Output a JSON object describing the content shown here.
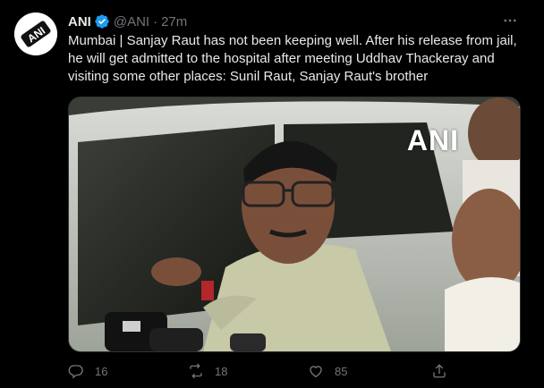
{
  "tweet": {
    "author_name": "ANI",
    "handle": "@ANI",
    "separator": "·",
    "time": "27m",
    "text": "Mumbai | Sanjay Raut has not been keeping well. After his release from jail,\nhe will get admitted to the hospital after meeting Uddhav Thackeray and\nvisiting some other places: Sunil Raut, Sanjay Raut's brother",
    "media_watermark": "ANI",
    "avatar_logo_text": "ANI"
  },
  "actions": {
    "replies": "16",
    "retweets": "18",
    "likes": "85"
  },
  "icons": {
    "verified": "verified-badge-icon",
    "more": "more-options-icon",
    "reply": "reply-icon",
    "retweet": "retweet-icon",
    "like": "heart-icon",
    "share": "share-icon"
  },
  "colors": {
    "background": "#000000",
    "text_primary": "#e7e9ea",
    "text_secondary": "#71767b",
    "verified_blue": "#1d9bf0"
  }
}
